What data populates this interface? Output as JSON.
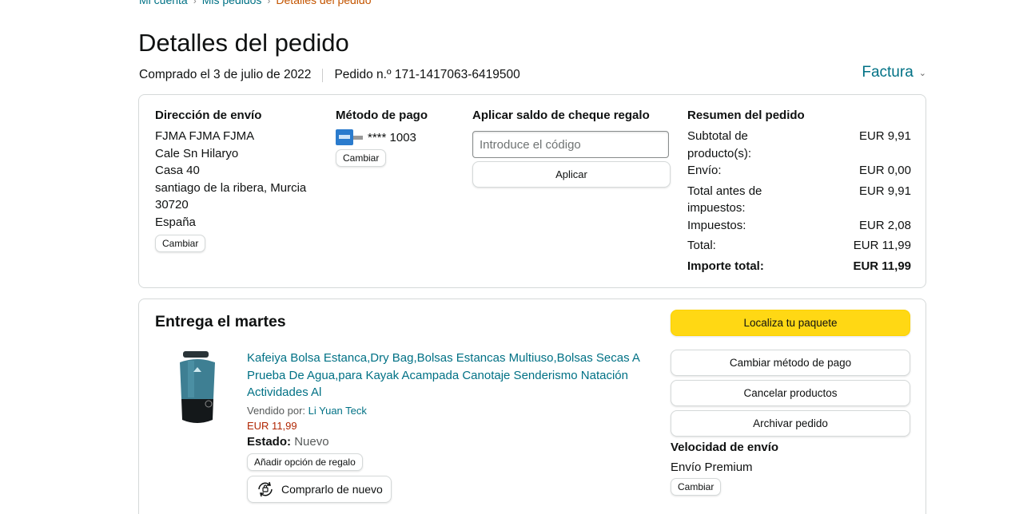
{
  "breadcrumb": {
    "items": [
      "Mi cuenta",
      "Mis pedidos"
    ],
    "current": "Detalles del pedido"
  },
  "page": {
    "title": "Detalles del pedido"
  },
  "order": {
    "purchased": "Comprado el 3 de julio de 2022",
    "number": "Pedido n.º 171-1417063-6419500"
  },
  "invoice": {
    "label": "Factura"
  },
  "shipping": {
    "heading": "Dirección de envío",
    "lines": [
      "FJMA FJMA FJMA",
      "Cale Sn Hilaryo",
      "Casa 40",
      "santiago de la ribera, Murcia",
      "30720",
      "España"
    ],
    "change": "Cambiar"
  },
  "payment": {
    "heading": "Método de pago",
    "card": "**** 1003",
    "change": "Cambiar"
  },
  "giftcard": {
    "heading": "Aplicar saldo de cheque regalo",
    "placeholder": "Introduce el código",
    "apply": "Aplicar"
  },
  "summary": {
    "heading": "Resumen del pedido",
    "rows": [
      {
        "label": "Subtotal de producto(s):",
        "value": "EUR 9,91"
      },
      {
        "label": "Envío:",
        "value": "EUR 0,00"
      },
      {
        "label": "Total antes de impuestos:",
        "value": "EUR 9,91"
      },
      {
        "label": "Impuestos:",
        "value": "EUR 2,08"
      },
      {
        "label": "Total:",
        "value": "EUR 11,99"
      },
      {
        "label": "Importe total:",
        "value": "EUR 11,99"
      }
    ]
  },
  "delivery": {
    "title": "Entrega el martes",
    "product": {
      "title": "Kafeiya Bolsa Estanca,Dry Bag,Bolsas Estancas Multiuso,Bolsas Secas A Prueba De Agua,para Kayak Acampada Canotaje Senderismo Natación Actividades Al",
      "sold_by_label": "Vendido por:",
      "seller": "Li Yuan Teck",
      "price": "EUR 11,99",
      "state_label": "Estado:",
      "state": "Nuevo",
      "gift_option": "Añadir opción de regalo",
      "rebuy": "Comprarlo de nuevo"
    },
    "actions": {
      "track": "Localiza tu paquete",
      "change_payment": "Cambiar método de pago",
      "cancel": "Cancelar productos",
      "archive": "Archivar pedido"
    },
    "speed": {
      "heading": "Velocidad de envío",
      "value": "Envío Premium",
      "change": "Cambiar"
    }
  },
  "colors": {
    "link": "#007185",
    "primary_button": "#ffd814",
    "price": "#b12704",
    "border": "#d5d9d9"
  }
}
